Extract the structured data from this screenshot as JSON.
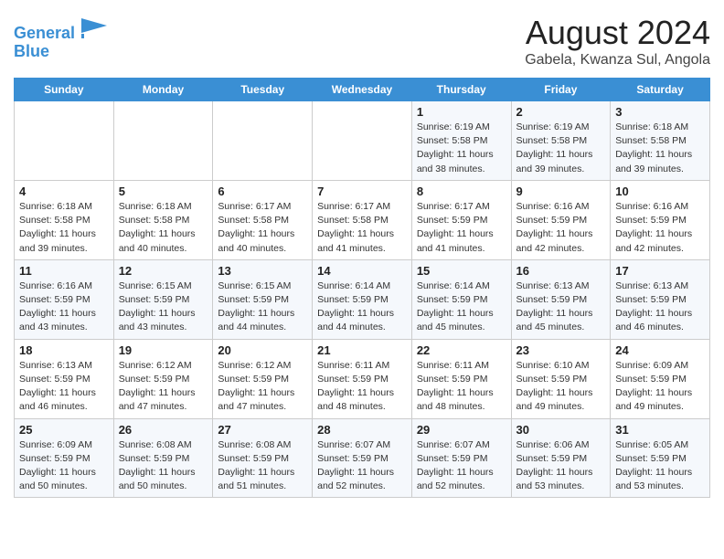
{
  "logo": {
    "line1": "General",
    "line2": "Blue"
  },
  "title": "August 2024",
  "location": "Gabela, Kwanza Sul, Angola",
  "days_of_week": [
    "Sunday",
    "Monday",
    "Tuesday",
    "Wednesday",
    "Thursday",
    "Friday",
    "Saturday"
  ],
  "weeks": [
    [
      {
        "day": "",
        "info": ""
      },
      {
        "day": "",
        "info": ""
      },
      {
        "day": "",
        "info": ""
      },
      {
        "day": "",
        "info": ""
      },
      {
        "day": "1",
        "info": "Sunrise: 6:19 AM\nSunset: 5:58 PM\nDaylight: 11 hours\nand 38 minutes."
      },
      {
        "day": "2",
        "info": "Sunrise: 6:19 AM\nSunset: 5:58 PM\nDaylight: 11 hours\nand 39 minutes."
      },
      {
        "day": "3",
        "info": "Sunrise: 6:18 AM\nSunset: 5:58 PM\nDaylight: 11 hours\nand 39 minutes."
      }
    ],
    [
      {
        "day": "4",
        "info": "Sunrise: 6:18 AM\nSunset: 5:58 PM\nDaylight: 11 hours\nand 39 minutes."
      },
      {
        "day": "5",
        "info": "Sunrise: 6:18 AM\nSunset: 5:58 PM\nDaylight: 11 hours\nand 40 minutes."
      },
      {
        "day": "6",
        "info": "Sunrise: 6:17 AM\nSunset: 5:58 PM\nDaylight: 11 hours\nand 40 minutes."
      },
      {
        "day": "7",
        "info": "Sunrise: 6:17 AM\nSunset: 5:58 PM\nDaylight: 11 hours\nand 41 minutes."
      },
      {
        "day": "8",
        "info": "Sunrise: 6:17 AM\nSunset: 5:59 PM\nDaylight: 11 hours\nand 41 minutes."
      },
      {
        "day": "9",
        "info": "Sunrise: 6:16 AM\nSunset: 5:59 PM\nDaylight: 11 hours\nand 42 minutes."
      },
      {
        "day": "10",
        "info": "Sunrise: 6:16 AM\nSunset: 5:59 PM\nDaylight: 11 hours\nand 42 minutes."
      }
    ],
    [
      {
        "day": "11",
        "info": "Sunrise: 6:16 AM\nSunset: 5:59 PM\nDaylight: 11 hours\nand 43 minutes."
      },
      {
        "day": "12",
        "info": "Sunrise: 6:15 AM\nSunset: 5:59 PM\nDaylight: 11 hours\nand 43 minutes."
      },
      {
        "day": "13",
        "info": "Sunrise: 6:15 AM\nSunset: 5:59 PM\nDaylight: 11 hours\nand 44 minutes."
      },
      {
        "day": "14",
        "info": "Sunrise: 6:14 AM\nSunset: 5:59 PM\nDaylight: 11 hours\nand 44 minutes."
      },
      {
        "day": "15",
        "info": "Sunrise: 6:14 AM\nSunset: 5:59 PM\nDaylight: 11 hours\nand 45 minutes."
      },
      {
        "day": "16",
        "info": "Sunrise: 6:13 AM\nSunset: 5:59 PM\nDaylight: 11 hours\nand 45 minutes."
      },
      {
        "day": "17",
        "info": "Sunrise: 6:13 AM\nSunset: 5:59 PM\nDaylight: 11 hours\nand 46 minutes."
      }
    ],
    [
      {
        "day": "18",
        "info": "Sunrise: 6:13 AM\nSunset: 5:59 PM\nDaylight: 11 hours\nand 46 minutes."
      },
      {
        "day": "19",
        "info": "Sunrise: 6:12 AM\nSunset: 5:59 PM\nDaylight: 11 hours\nand 47 minutes."
      },
      {
        "day": "20",
        "info": "Sunrise: 6:12 AM\nSunset: 5:59 PM\nDaylight: 11 hours\nand 47 minutes."
      },
      {
        "day": "21",
        "info": "Sunrise: 6:11 AM\nSunset: 5:59 PM\nDaylight: 11 hours\nand 48 minutes."
      },
      {
        "day": "22",
        "info": "Sunrise: 6:11 AM\nSunset: 5:59 PM\nDaylight: 11 hours\nand 48 minutes."
      },
      {
        "day": "23",
        "info": "Sunrise: 6:10 AM\nSunset: 5:59 PM\nDaylight: 11 hours\nand 49 minutes."
      },
      {
        "day": "24",
        "info": "Sunrise: 6:09 AM\nSunset: 5:59 PM\nDaylight: 11 hours\nand 49 minutes."
      }
    ],
    [
      {
        "day": "25",
        "info": "Sunrise: 6:09 AM\nSunset: 5:59 PM\nDaylight: 11 hours\nand 50 minutes."
      },
      {
        "day": "26",
        "info": "Sunrise: 6:08 AM\nSunset: 5:59 PM\nDaylight: 11 hours\nand 50 minutes."
      },
      {
        "day": "27",
        "info": "Sunrise: 6:08 AM\nSunset: 5:59 PM\nDaylight: 11 hours\nand 51 minutes."
      },
      {
        "day": "28",
        "info": "Sunrise: 6:07 AM\nSunset: 5:59 PM\nDaylight: 11 hours\nand 52 minutes."
      },
      {
        "day": "29",
        "info": "Sunrise: 6:07 AM\nSunset: 5:59 PM\nDaylight: 11 hours\nand 52 minutes."
      },
      {
        "day": "30",
        "info": "Sunrise: 6:06 AM\nSunset: 5:59 PM\nDaylight: 11 hours\nand 53 minutes."
      },
      {
        "day": "31",
        "info": "Sunrise: 6:05 AM\nSunset: 5:59 PM\nDaylight: 11 hours\nand 53 minutes."
      }
    ]
  ]
}
